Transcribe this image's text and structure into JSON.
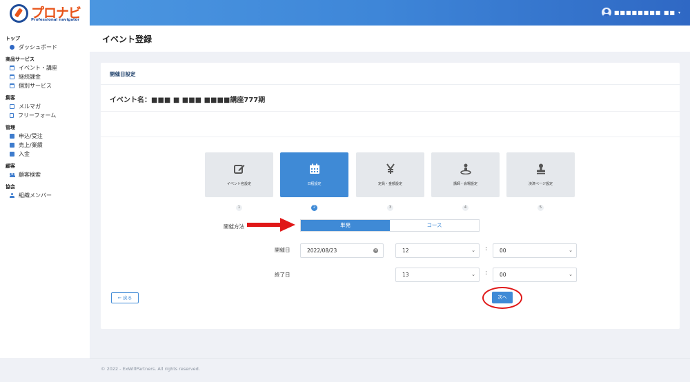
{
  "brand": {
    "name": "プロナビ",
    "tagline": "Professional navigator"
  },
  "header": {
    "user_name": "■■■■■■■■ ■■",
    "caret": "▾"
  },
  "sidebar": {
    "groups": [
      {
        "title": "トップ",
        "items": [
          {
            "label": "ダッシュボード",
            "icon": "dashboard-icon"
          }
        ]
      },
      {
        "title": "商品サービス",
        "items": [
          {
            "label": "イベント・講座",
            "icon": "calendar-icon"
          },
          {
            "label": "継続課金",
            "icon": "calendar-icon"
          },
          {
            "label": "個別サービス",
            "icon": "calendar-icon"
          }
        ]
      },
      {
        "title": "集客",
        "items": [
          {
            "label": "メルマガ",
            "icon": "mail-icon"
          },
          {
            "label": "フリーフォーム",
            "icon": "document-icon"
          }
        ]
      },
      {
        "title": "管理",
        "items": [
          {
            "label": "申込/受注",
            "icon": "box-icon"
          },
          {
            "label": "売上/業績",
            "icon": "box-icon"
          },
          {
            "label": "入金",
            "icon": "box-icon"
          }
        ]
      },
      {
        "title": "顧客",
        "items": [
          {
            "label": "顧客検索",
            "icon": "users-icon"
          }
        ]
      },
      {
        "title": "協会",
        "items": [
          {
            "label": "組織メンバー",
            "icon": "user-icon"
          }
        ]
      }
    ]
  },
  "page": {
    "title": "イベント登録"
  },
  "card": {
    "heading": "開催日設定",
    "event_name_label": "イベント名：",
    "event_name_value": "■■■ ■ ■■■ ■■■■講座777期"
  },
  "steps": [
    {
      "label": "イベント名設定",
      "number": "1",
      "icon": "edit-icon",
      "active": false
    },
    {
      "label": "日程設定",
      "number": "2",
      "icon": "calendar-icon",
      "active": true
    },
    {
      "label": "定員・金額設定",
      "number": "3",
      "icon": "yen-icon",
      "active": false
    },
    {
      "label": "講師・会場設定",
      "number": "4",
      "icon": "location-person-icon",
      "active": false
    },
    {
      "label": "決済ページ設定",
      "number": "5",
      "icon": "stamp-icon",
      "active": false
    }
  ],
  "form": {
    "method_label": "開催方法",
    "method_options": [
      "単発",
      "コース"
    ],
    "method_selected": "単発",
    "start_label": "開催日",
    "start_date": "2022/08/23",
    "start_hour": "12",
    "start_minute": "00",
    "end_label": "終了日",
    "end_hour": "13",
    "end_minute": "00",
    "colon": ":"
  },
  "buttons": {
    "back": "← 戻る",
    "next": "次へ"
  },
  "footer": {
    "text": "© 2022 - ExWillPartners. All rights reserved."
  },
  "colors": {
    "primary": "#3f8ad6",
    "accent": "#e8541a",
    "annotation": "#e01818"
  }
}
